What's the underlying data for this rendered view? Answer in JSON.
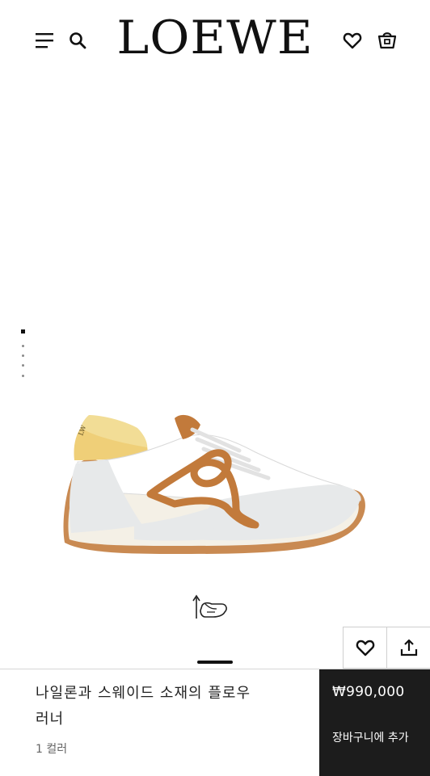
{
  "brand": {
    "logo": "LOEWE"
  },
  "header_icons": {
    "menu": "menu-icon",
    "search": "search-icon",
    "wishlist": "heart-icon",
    "bag": "shopping-bag-icon"
  },
  "gallery": {
    "image_count": 4,
    "active_index": 0,
    "colors": {
      "tan": "#c27a3b",
      "cream": "#f2dd96",
      "grey": "#e7e9ea",
      "sole_white": "#f4f0e6"
    }
  },
  "actions": {
    "wishlist": "heart-icon",
    "share": "share-icon"
  },
  "product": {
    "name": "나일론과 스웨이드 소재의 플로우 러너",
    "color_count": "1 컬러",
    "price": "₩990,000",
    "add_to_cart": "장바구니에 추가"
  }
}
